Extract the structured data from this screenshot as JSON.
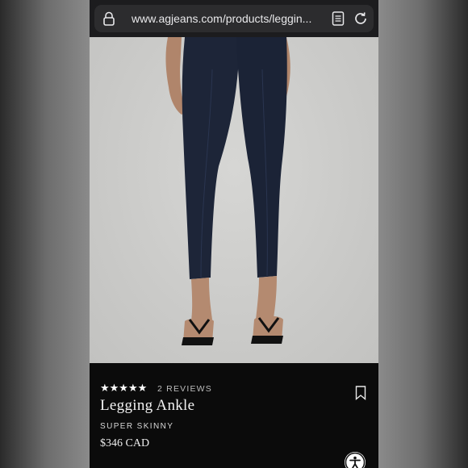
{
  "browser": {
    "url": "www.agjeans.com/products/leggin...",
    "icons": [
      "lock-icon",
      "reader-icon",
      "reload-icon"
    ]
  },
  "product": {
    "rating_stars": "★★★★★",
    "rating_value": 5,
    "reviews_label": "2 REVIEWS",
    "name": "Legging Ankle",
    "fit": "SUPER SKINNY",
    "price": "$346 CAD"
  },
  "icons": {
    "bookmark": "bookmark-icon",
    "accessibility": "accessibility-icon"
  },
  "colors": {
    "panel_bg": "#0b0b0b",
    "photo_bg": "#cbcbc9",
    "denim": "#1d2538"
  }
}
